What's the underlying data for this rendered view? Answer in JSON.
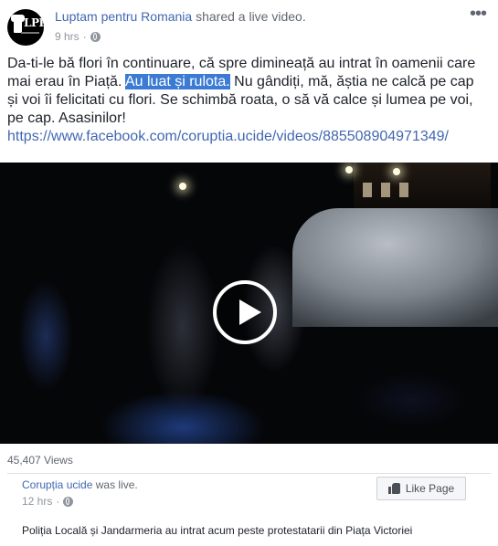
{
  "post": {
    "author": "Luptam pentru Romania",
    "action": " shared a live video.",
    "time": "9 hrs",
    "separator": "·",
    "avatar_text": "LPR",
    "more_label": "•••",
    "text_before": "Da-ti-le bă flori în continuare, că spre dimineață au intrat în oamenii care mai erau în Piață. ",
    "text_highlighted": "Au luat și rulota.",
    "text_after": " Nu gândiți, mă, ăștia ne calcă pe cap și voi îi felicitati cu flori. Se schimbă roata, o să vă calce și lumea pe voi, pe cap. Asasinilor!",
    "link": "https://www.facebook.com/coruptia.ucide/videos/885508904971349/"
  },
  "video": {
    "views": "45,407 Views"
  },
  "shared": {
    "name": "Corupția ucide",
    "suffix": " was live.",
    "time": "12 hrs",
    "separator": "·",
    "like_button": "Like Page",
    "description": "Poliția Locală și Jandarmeria au intrat acum peste protestatarii din Piața Victoriei"
  },
  "icons": {
    "privacy": "globe-icon",
    "like": "thumbs-up-icon",
    "play": "play-icon"
  },
  "colors": {
    "link": "#4267b2",
    "highlight": "#3b7bd4",
    "meta": "#90949c"
  }
}
